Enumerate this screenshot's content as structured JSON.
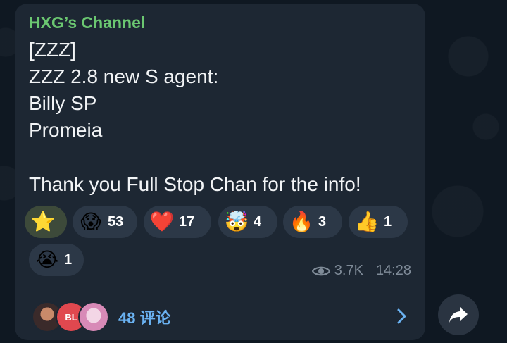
{
  "channel": {
    "name": "HXG’s Channel"
  },
  "message": {
    "lines": [
      "[ZZZ]",
      "ZZZ 2.8 new S agent:",
      "Billy SP",
      "Promeia",
      "",
      "Thank you Full Stop Chan for the info!"
    ]
  },
  "reactions": [
    {
      "emoji": "⭐",
      "icon": "star-icon",
      "count": "",
      "selected": true
    },
    {
      "emoji": "😱",
      "icon": "scream-face-icon",
      "count": "53"
    },
    {
      "emoji": "❤️",
      "icon": "heart-icon",
      "count": "17"
    },
    {
      "emoji": "🤯",
      "icon": "mind-blown-icon",
      "count": "4"
    },
    {
      "emoji": "🔥",
      "icon": "fire-icon",
      "count": "3"
    },
    {
      "emoji": "👍",
      "icon": "thumbs-up-icon",
      "count": "1"
    },
    {
      "emoji": "😭",
      "icon": "crying-face-icon",
      "count": "1"
    }
  ],
  "meta": {
    "views": "3.7K",
    "time": "14:28"
  },
  "comments": {
    "label": "48 评论",
    "avatar_badge": "BL"
  },
  "colors": {
    "bubble": "#1d2733",
    "channel_name": "#6bc771",
    "link": "#6ab2f2",
    "reaction_bg": "#2c3847"
  }
}
